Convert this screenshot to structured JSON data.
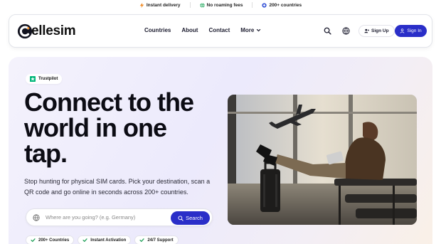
{
  "topbar": {
    "items": [
      {
        "label": "Instant delivery",
        "icon": "bolt-icon"
      },
      {
        "label": "No roaming fees",
        "icon": "globe-icon"
      },
      {
        "label": "200+ countries",
        "icon": "signal-icon"
      }
    ]
  },
  "header": {
    "logo_text": "ellesim",
    "nav": [
      "Countries",
      "About",
      "Contact",
      "More"
    ],
    "signup_label": "Sign Up",
    "signin_label": "Sign In"
  },
  "hero": {
    "badge": "Trustpilot",
    "headline": [
      "Connect to the",
      "world in one",
      "tap."
    ],
    "subtext": "Stop hunting for physical SIM cards. Pick your destination, scan a QR code and go online in seconds across 200+ countries.",
    "search_placeholder": "Where are you going? (e.g. Germany)",
    "search_button": "Search",
    "chips": [
      "200+ Countries",
      "Instant Activation",
      "24/7 Support"
    ]
  },
  "colors": {
    "accent": "#2a2ec8",
    "trust_green": "#00b67a",
    "check_green": "#22a05a"
  }
}
